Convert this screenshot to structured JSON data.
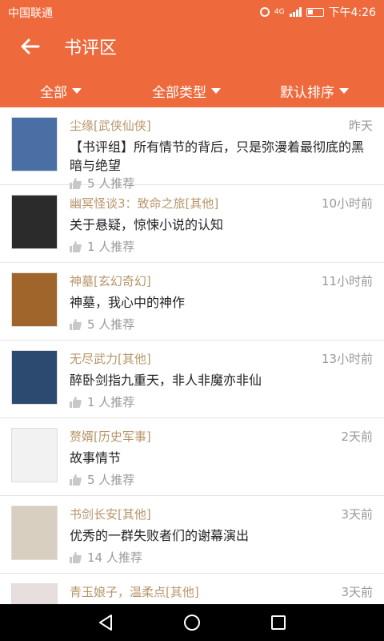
{
  "status": {
    "carrier": "中国联通",
    "network": "4G",
    "time": "下午4:26"
  },
  "header": {
    "title": "书评区"
  },
  "filters": [
    {
      "label": "全部"
    },
    {
      "label": "全部类型"
    },
    {
      "label": "默认排序"
    }
  ],
  "reviews": [
    {
      "book": "尘缘[武侠仙侠]",
      "time": "昨天",
      "text": "【书评组】所有情节的背后，只是弥漫着最彻底的黑暗与绝望",
      "rec": "5 人推荐",
      "cover_color": "#4a6fa5"
    },
    {
      "book": "幽冥怪谈3：致命之旅[其他]",
      "time": "10小时前",
      "text": "关于悬疑，惊悚小说的认知",
      "rec": "1 人推荐",
      "cover_color": "#2b2b2b"
    },
    {
      "book": "神墓[玄幻奇幻]",
      "time": "11小时前",
      "text": "神墓，我心中的神作",
      "rec": "5 人推荐",
      "cover_color": "#a0652a"
    },
    {
      "book": "无尽武力[其他]",
      "time": "13小时前",
      "text": "醉卧剑指九重天，非人非魔亦非仙",
      "rec": "1 人推荐",
      "cover_color": "#2c4a70"
    },
    {
      "book": "赘婿[历史军事]",
      "time": "2天前",
      "text": "故事情节",
      "rec": "5 人推荐",
      "cover_color": "#f2f2f2"
    },
    {
      "book": "书剑长安[其他]",
      "time": "3天前",
      "text": "优秀的一群失败者们的谢幕演出",
      "rec": "14 人推荐",
      "cover_color": "#d9cfc0"
    },
    {
      "book": "青玉娘子，温柔点[其他]",
      "time": "3天前",
      "text": "",
      "rec": "",
      "cover_color": "#e9dede"
    }
  ]
}
